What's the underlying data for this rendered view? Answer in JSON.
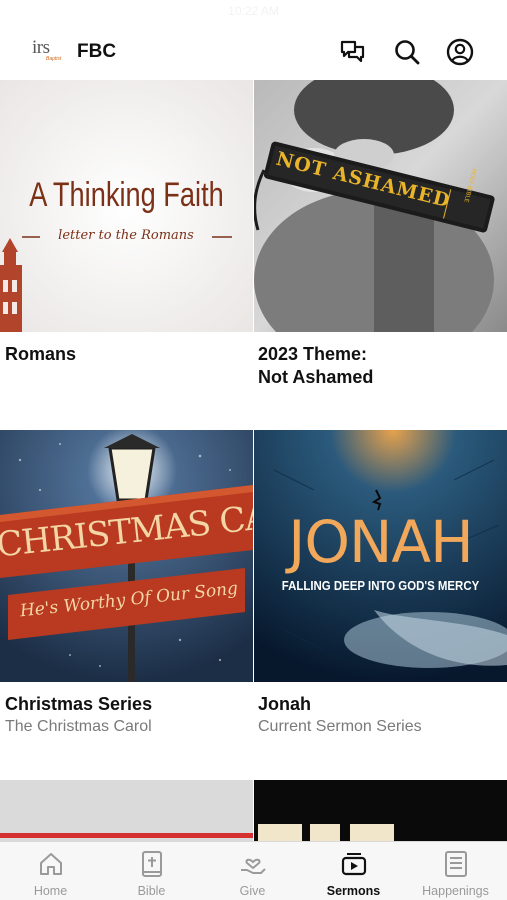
{
  "status_bar": {
    "time": "10:22 AM"
  },
  "header": {
    "logo_text": "irs",
    "logo_subtext": "Baptist",
    "title": "FBC",
    "icons": [
      "chat-icon",
      "search-icon",
      "account-icon"
    ]
  },
  "series": [
    {
      "title": "Romans",
      "subtitle": "",
      "art_title": "A Thinking Faith",
      "art_subtitle": "letter to the Romans"
    },
    {
      "title": "2023 Theme:\nNot Ashamed",
      "subtitle": "",
      "art_title": "NOT ASHAMED",
      "art_spine": "HOLY BIBLE"
    },
    {
      "title": "Christmas Series",
      "subtitle": "The Christmas Carol",
      "art_title": "CHRISTMAS CAROL",
      "art_subtitle": "He's Worthy Of Our Song"
    },
    {
      "title": "Jonah",
      "subtitle": "Current Sermon Series",
      "art_title": "JONAH",
      "art_subtitle": "FALLING DEEP INTO GOD'S MERCY"
    }
  ],
  "tabs": [
    {
      "label": "Home",
      "icon": "home-icon",
      "active": false
    },
    {
      "label": "Bible",
      "icon": "bible-icon",
      "active": false
    },
    {
      "label": "Give",
      "icon": "give-icon",
      "active": false
    },
    {
      "label": "Sermons",
      "icon": "sermons-icon",
      "active": true
    },
    {
      "label": "Happenings",
      "icon": "happenings-icon",
      "active": false
    }
  ],
  "colors": {
    "accent_red": "#d62f2f",
    "faith_brown": "#7b3018",
    "not_ashamed_gold": "#e9b42a",
    "jonah_orange": "#f2a85a"
  }
}
